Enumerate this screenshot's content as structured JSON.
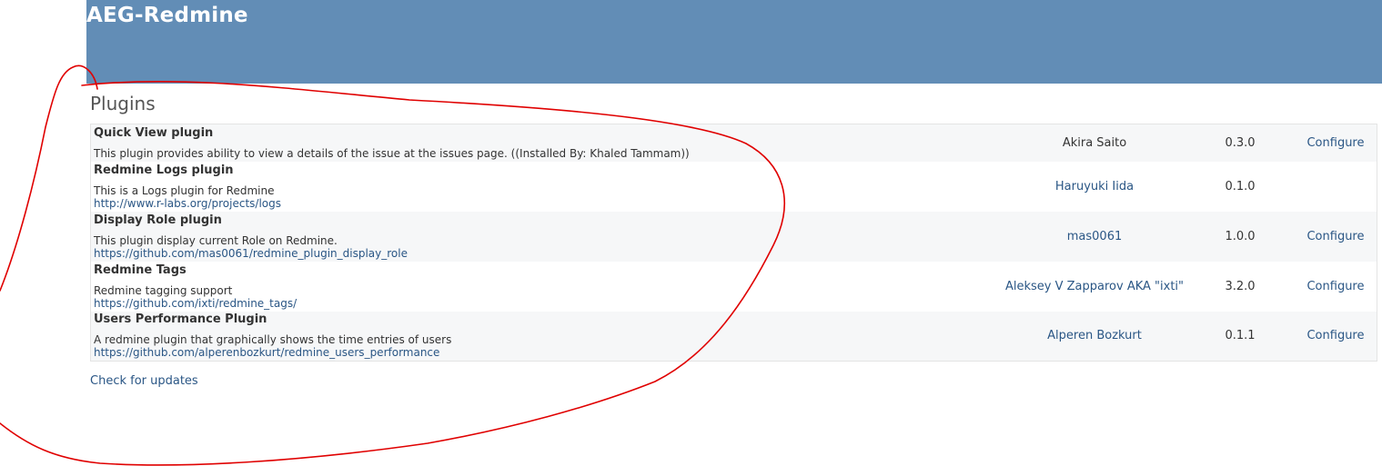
{
  "header": {
    "title": "AEG-Redmine"
  },
  "page": {
    "title": "Plugins",
    "check_updates_label": "Check for updates"
  },
  "plugins": [
    {
      "name": "Quick View plugin",
      "description": "This plugin provides ability to view a details of the issue at the issues page. ((Installed By: Khaled Tammam))",
      "url": "",
      "author": "Akira Saito",
      "author_is_link": false,
      "version": "0.3.0",
      "configure": "Configure"
    },
    {
      "name": "Redmine Logs plugin",
      "description": "This is a Logs plugin for Redmine",
      "url": "http://www.r-labs.org/projects/logs",
      "author": "Haruyuki Iida",
      "author_is_link": true,
      "version": "0.1.0",
      "configure": ""
    },
    {
      "name": "Display Role plugin",
      "description": "This plugin display current Role on Redmine.",
      "url": "https://github.com/mas0061/redmine_plugin_display_role",
      "author": "mas0061",
      "author_is_link": true,
      "version": "1.0.0",
      "configure": "Configure"
    },
    {
      "name": "Redmine Tags",
      "description": "Redmine tagging support",
      "url": "https://github.com/ixti/redmine_tags/",
      "author": "Aleksey V Zapparov AKA \"ixti\"",
      "author_is_link": true,
      "version": "3.2.0",
      "configure": "Configure"
    },
    {
      "name": "Users Performance Plugin",
      "description": "A redmine plugin that graphically shows the time entries of users",
      "url": "https://github.com/alperenbozkurt/redmine_users_performance",
      "author": "Alperen Bozkurt",
      "author_is_link": true,
      "version": "0.1.1",
      "configure": "Configure"
    }
  ],
  "colors": {
    "header_bg": "#628db6",
    "link": "#2a5685",
    "row_odd": "#f6f7f8",
    "annotation": "#e00000"
  }
}
